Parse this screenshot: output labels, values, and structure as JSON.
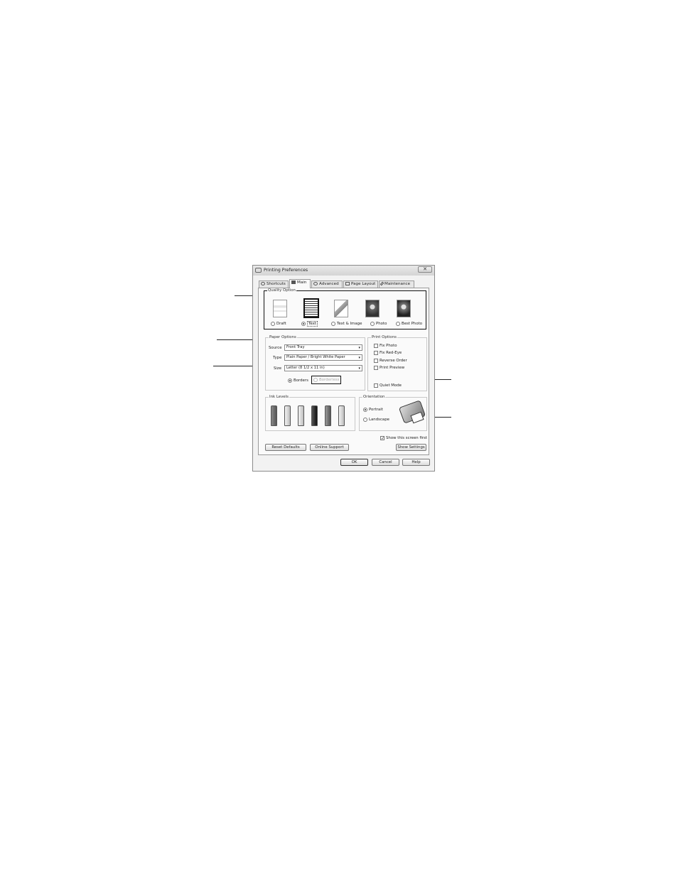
{
  "window": {
    "title": "Printing Preferences",
    "close_symbol": "✕"
  },
  "tabs": [
    {
      "label": "Shortcuts",
      "icon": "star-icon"
    },
    {
      "label": "Main",
      "icon": "printer-icon"
    },
    {
      "label": "Advanced",
      "icon": "gear-icon"
    },
    {
      "label": "Page Layout",
      "icon": "page-icon"
    },
    {
      "label": "Maintenance",
      "icon": "wrench-icon"
    }
  ],
  "quality_option": {
    "label": "Quality Option",
    "options": [
      {
        "label": "Draft",
        "selected": false
      },
      {
        "label": "Text",
        "selected": true
      },
      {
        "label": "Text & Image",
        "selected": false
      },
      {
        "label": "Photo",
        "selected": false
      },
      {
        "label": "Best Photo",
        "selected": false
      }
    ]
  },
  "paper_options": {
    "label": "Paper Options",
    "source_label": "Source",
    "source_value": "Front Tray",
    "type_label": "Type",
    "type_value": "Plain Paper / Bright White Paper",
    "size_label": "Size",
    "size_value": "Letter (8 1/2 x 11 in)",
    "borders_label": "Borders",
    "borderless_label": "Borderless",
    "borders_selected": true
  },
  "print_options": {
    "label": "Print Options",
    "items": [
      {
        "label": "Fix Photo",
        "checked": false
      },
      {
        "label": "Fix Red-Eye",
        "checked": false
      },
      {
        "label": "Reverse Order",
        "checked": false
      },
      {
        "label": "Print Preview",
        "checked": false
      }
    ],
    "quiet_mode_label": "Quiet Mode"
  },
  "ink_levels": {
    "label": "Ink Levels"
  },
  "orientation": {
    "label": "Orientation",
    "portrait": "Portrait",
    "landscape": "Landscape",
    "selected": "Portrait"
  },
  "show_screen_first": {
    "label": "Show this screen first",
    "checked": true,
    "check_mark": "✓"
  },
  "buttons": {
    "reset_defaults": "Reset Defaults",
    "online_support": "Online Support",
    "show_settings": "Show Settings",
    "ok": "OK",
    "cancel": "Cancel",
    "help": "Help"
  },
  "arrow_symbol": "▾"
}
